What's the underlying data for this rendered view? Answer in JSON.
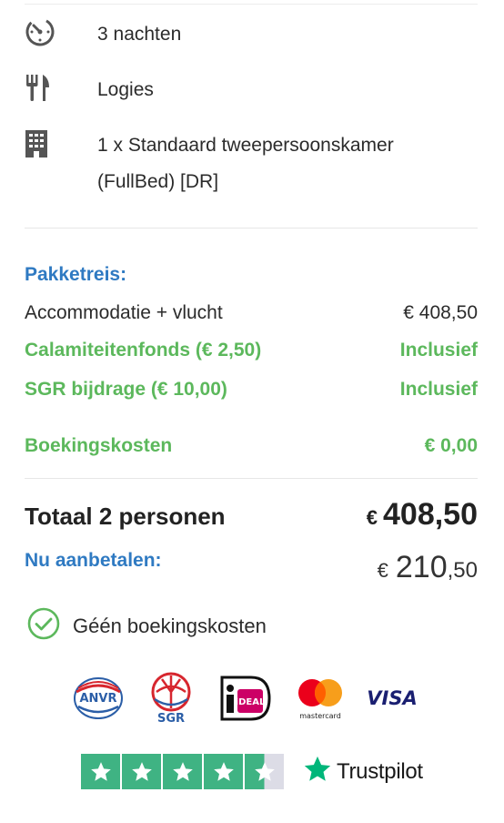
{
  "details": {
    "nights": "3 nachten",
    "board": "Logies",
    "room_line1": "1 x Standaard tweepersoonskamer",
    "room_line2": "(FullBed) [DR]"
  },
  "pricing": {
    "package_label": "Pakketreis:",
    "accommodation_label": "Accommodatie + vlucht",
    "accommodation_value": "€ 408,50",
    "calamity_label": "Calamiteitenfonds (€ 2,50)",
    "calamity_value": "Inclusief",
    "sgr_label": "SGR bijdrage (€ 10,00)",
    "sgr_value": "Inclusief",
    "booking_fee_label": "Boekingskosten",
    "booking_fee_value": "€ 0,00"
  },
  "total": {
    "label": "Totaal 2 personen",
    "currency": "€",
    "amount": "408,50"
  },
  "deposit": {
    "label": "Nu aanbetalen:",
    "currency": "€",
    "amount_int": "210",
    "amount_dec": ",50"
  },
  "no_fee": {
    "text": "Géén boekingskosten",
    "icon": "check-circle-icon"
  },
  "payment_logos": {
    "anvr": "ANVR",
    "sgr": "SGR",
    "ideal": "iDEAL",
    "mastercard": "mastercard",
    "visa": "VISA"
  },
  "trustpilot": {
    "brand": "Trustpilot",
    "rating_stars": 4.5
  },
  "colors": {
    "blue": "#2f7ac2",
    "green": "#5cb85c",
    "trustpilot_green": "#3fb383"
  }
}
